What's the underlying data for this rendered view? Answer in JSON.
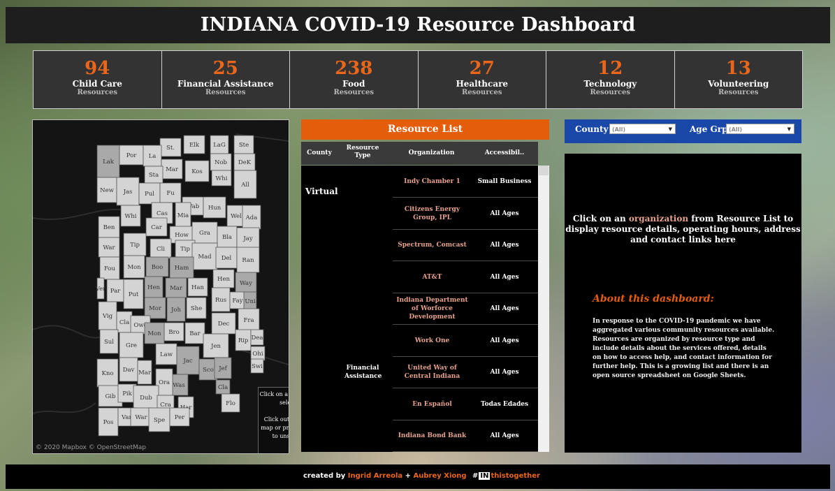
{
  "header": {
    "title": "INDIANA COVID-19 Resource Dashboard"
  },
  "stats": [
    {
      "count": "94",
      "label": "Child Care",
      "sub": "Resources"
    },
    {
      "count": "25",
      "label": "Financial Assistance",
      "sub": "Resources"
    },
    {
      "count": "238",
      "label": "Food",
      "sub": "Resources"
    },
    {
      "count": "27",
      "label": "Healthcare",
      "sub": "Resources"
    },
    {
      "count": "12",
      "label": "Technology",
      "sub": "Resources"
    },
    {
      "count": "13",
      "label": "Volunteering",
      "sub": "Resources"
    }
  ],
  "map": {
    "counties": [
      "LaG",
      "Ste",
      "Elk",
      "St.",
      "Lak",
      "Por",
      "La",
      "Nob",
      "DeK",
      "Kos",
      "Mar",
      "Sta",
      "Whi",
      "All",
      "New",
      "Jas",
      "Pul",
      "Fu",
      "Wab",
      "Hun",
      "Whi",
      "Cas",
      "Mia",
      "Wel",
      "Ada",
      "Ben",
      "Car",
      "How",
      "Gra",
      "Bla",
      "Jay",
      "Tip",
      "Cli",
      "Tip",
      "Mad",
      "Del",
      "Ran",
      "War",
      "Fou",
      "Mon",
      "Boo",
      "Ham",
      "Hen",
      "Way",
      "Ver",
      "Par",
      "Put",
      "Hen",
      "Mar",
      "Han",
      "Rus",
      "Fay",
      "Uni",
      "Mor",
      "Joh",
      "She",
      "Vig",
      "Cla",
      "Owe",
      "Dec",
      "Fra",
      "Sul",
      "Gre",
      "Bro",
      "Bar",
      "Rip",
      "Dea",
      "Mon",
      "Jen",
      "Ohi",
      "Law",
      "Jac",
      "Swi",
      "Kno",
      "Dav",
      "Mar",
      "Sco",
      "Jef",
      "Was",
      "Ora",
      "Cla",
      "Gib",
      "Pik",
      "Dub",
      "Flo",
      "Cra",
      "Har",
      "Pos",
      "Van",
      "War",
      "Spe",
      "Per"
    ],
    "help_text_1": "Click on a county to select",
    "help_text_2": "Click outside the map or press \"Esc\" to unselect",
    "attribution": "© 2020 Mapbox  © OpenStreetMap"
  },
  "resource_list": {
    "title": "Resource List",
    "columns": {
      "county": "County",
      "type": "Resource Type",
      "org": "Organization",
      "access": "Accessibil.."
    },
    "region": "Virtual",
    "type_label": "Financial Assistance",
    "rows": [
      {
        "org": "Indy Chamber 1",
        "access": "Small Business"
      },
      {
        "org": "Citizens Energy Group, IPL",
        "access": "All Ages"
      },
      {
        "org": "Spectrum, Comcast",
        "access": "All Ages"
      },
      {
        "org": "AT&T",
        "access": "All Ages"
      },
      {
        "org": "Indiana Department of Worforce Development",
        "access": "All Ages"
      },
      {
        "org": "Work One",
        "access": "All Ages"
      },
      {
        "org": "United Way of Central Indiana",
        "access": "All Ages"
      },
      {
        "org": "En Español",
        "access": "Todas Edades"
      },
      {
        "org": "Indiana Bond Bank",
        "access": "All Ages"
      }
    ]
  },
  "filters": {
    "county_label": "County",
    "county_value": "(All)",
    "age_label": "Age Grp",
    "age_value": "(All)"
  },
  "info": {
    "prompt_pre": "Click on an ",
    "prompt_highlight": "organization",
    "prompt_post": " from Resource List to display resource details, operating hours, address and contact links here",
    "about_title": "About this dashboard:",
    "about_text": "In response to the COVID-19 pandemic we have aggregated various community resources available. Resources are organized by resource type and include details about the services offered, details on how to access help, and contact information for further help. This is a growing list and there is an open source spreadsheet on Google Sheets."
  },
  "footer": {
    "created_by": "created by ",
    "author1": "Ingrid Arreola",
    "plus": " + ",
    "author2": "Aubrey Xiong",
    "hashtag_hash": "#",
    "hashtag_box": "IN",
    "hashtag_rest": "thistogether"
  }
}
